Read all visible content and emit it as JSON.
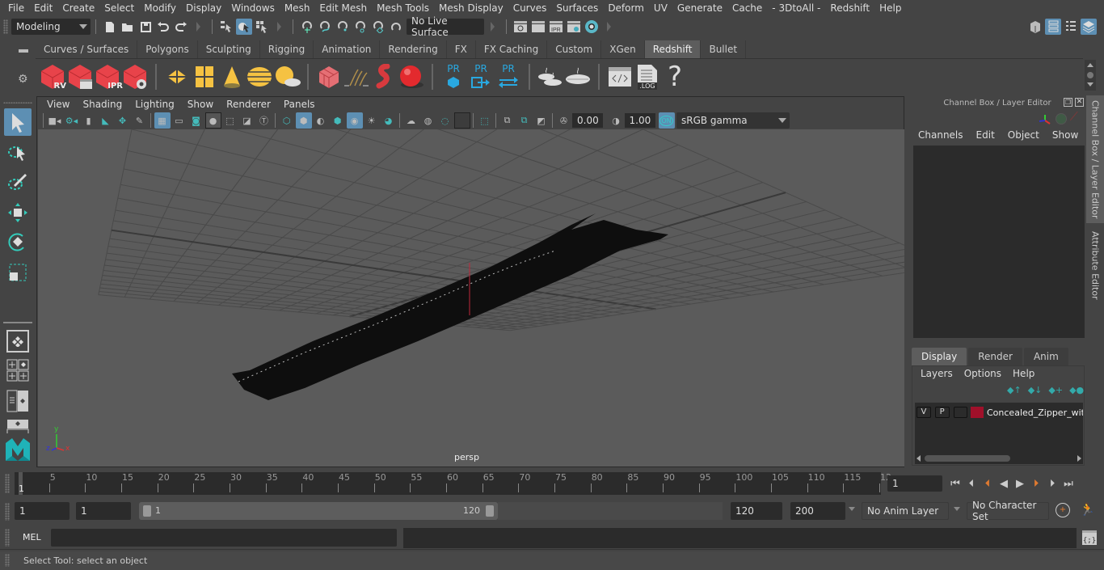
{
  "menubar": {
    "items": [
      "File",
      "Edit",
      "Create",
      "Select",
      "Modify",
      "Display",
      "Windows",
      "Mesh",
      "Edit Mesh",
      "Mesh Tools",
      "Mesh Display",
      "Curves",
      "Surfaces",
      "Deform",
      "UV",
      "Generate",
      "Cache",
      "- 3DtoAll -",
      "Redshift",
      "Help"
    ]
  },
  "statusline": {
    "mode": "Modeling",
    "live_surface": "No Live Surface",
    "icons": [
      "new-scene-icon",
      "open-scene-icon",
      "save-scene-icon",
      "undo-icon",
      "redo-icon",
      "select-hierarchy-icon",
      "select-object-icon",
      "select-component-icon",
      "snap-grid-icon",
      "snap-curve-icon",
      "snap-point-icon",
      "snap-view-plane-icon",
      "snap-surface-icon",
      "make-live-icon",
      "render-view-icon",
      "render-frame-icon",
      "ipr-render-icon",
      "render-settings-icon",
      "hypershade-icon"
    ],
    "right_icons": [
      "modeling-toolkit-icon",
      "attribute-editor-icon",
      "tool-settings-icon",
      "channel-box-icon"
    ]
  },
  "shelf": {
    "tabs": [
      "Curves / Surfaces",
      "Polygons",
      "Sculpting",
      "Rigging",
      "Animation",
      "Rendering",
      "FX",
      "FX Caching",
      "Custom",
      "XGen",
      "Redshift",
      "Bullet"
    ],
    "active_tab": "Redshift",
    "icon_labels": {
      "rv": "RV",
      "ipr": "IPR",
      "pr": "PR",
      "log": ".LOG",
      "help": "?"
    }
  },
  "viewport": {
    "menu": [
      "View",
      "Shading",
      "Lighting",
      "Show",
      "Renderer",
      "Panels"
    ],
    "exposure": "0.00",
    "gamma": "1.00",
    "color_mgmt": "ON",
    "color_space": "sRGB gamma",
    "camera_label": "persp",
    "axis": {
      "x": "x",
      "y": "y",
      "z": "z"
    }
  },
  "channel_box": {
    "title": "Channel Box / Layer Editor",
    "menu": [
      "Channels",
      "Edit",
      "Object",
      "Show"
    ]
  },
  "layer_editor": {
    "tabs": [
      "Display",
      "Render",
      "Anim"
    ],
    "active_tab": "Display",
    "menu": [
      "Layers",
      "Options",
      "Help"
    ],
    "layers": [
      {
        "v": "V",
        "p": "P",
        "color": "#a0102a",
        "name": "Concealed_Zipper_wit"
      }
    ]
  },
  "side_tabs": {
    "channel_box": "Channel Box / Layer Editor",
    "attribute_editor": "Attribute Editor"
  },
  "timeline": {
    "ticks": [
      5,
      10,
      15,
      20,
      25,
      30,
      35,
      40,
      45,
      50,
      55,
      60,
      65,
      70,
      75,
      80,
      85,
      90,
      95,
      100,
      105,
      110,
      115,
      "12"
    ],
    "current_frame_marker": "1",
    "current_frame": "1",
    "range_start": 1,
    "range_end": 120
  },
  "range": {
    "start": "1",
    "playback_start": "1",
    "slider_start": "1",
    "slider_end": "120",
    "playback_end": "120",
    "end": "200",
    "anim_layer": "No Anim Layer",
    "character_set": "No Character Set"
  },
  "command": {
    "language": "MEL",
    "input": "",
    "output": ""
  },
  "helpline": {
    "text": "Select Tool: select an object"
  },
  "colors": {
    "accent": "#5d8fb3",
    "redshift_red": "#e03a3e",
    "shelf_yellow": "#f5c242",
    "pr_blue": "#29a8e0",
    "layer_color": "#a0102a"
  }
}
